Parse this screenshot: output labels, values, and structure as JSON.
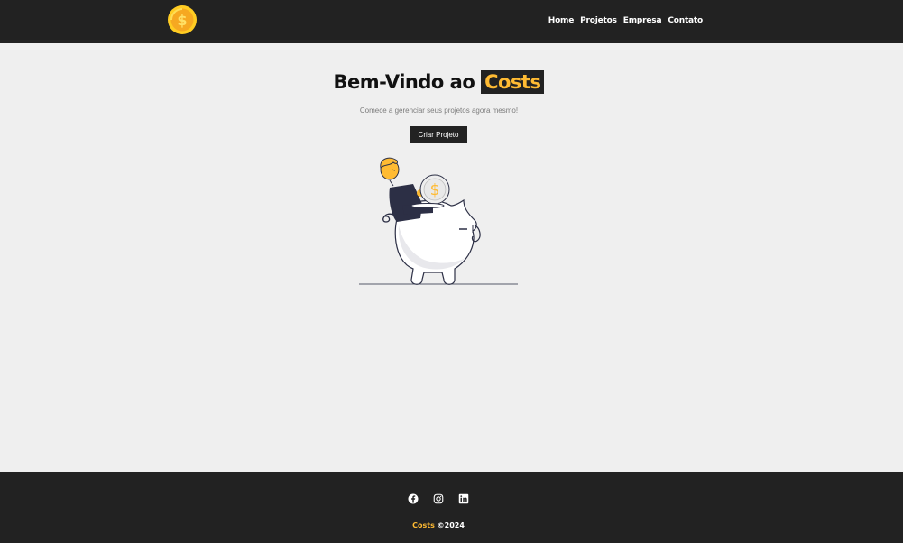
{
  "navbar": {
    "logo_icon": "dollar-coin-icon",
    "links": [
      {
        "label": "Home"
      },
      {
        "label": "Projetos"
      },
      {
        "label": "Empresa"
      },
      {
        "label": "Contato"
      }
    ]
  },
  "hero": {
    "title_prefix": "Bem-Vindo ao",
    "title_brand": "Costs",
    "subtitle": "Comece a gerenciar seus projetos agora mesmo!",
    "button_label": "Criar Projeto",
    "illustration": "piggy-bank-savings-illustration"
  },
  "footer": {
    "social_icons": [
      "facebook-icon",
      "instagram-icon",
      "linkedin-icon"
    ],
    "brand": "Costs",
    "copyright": "©2024"
  },
  "colors": {
    "dark": "#222222",
    "accent": "#ffbb33",
    "background": "#efefef"
  }
}
